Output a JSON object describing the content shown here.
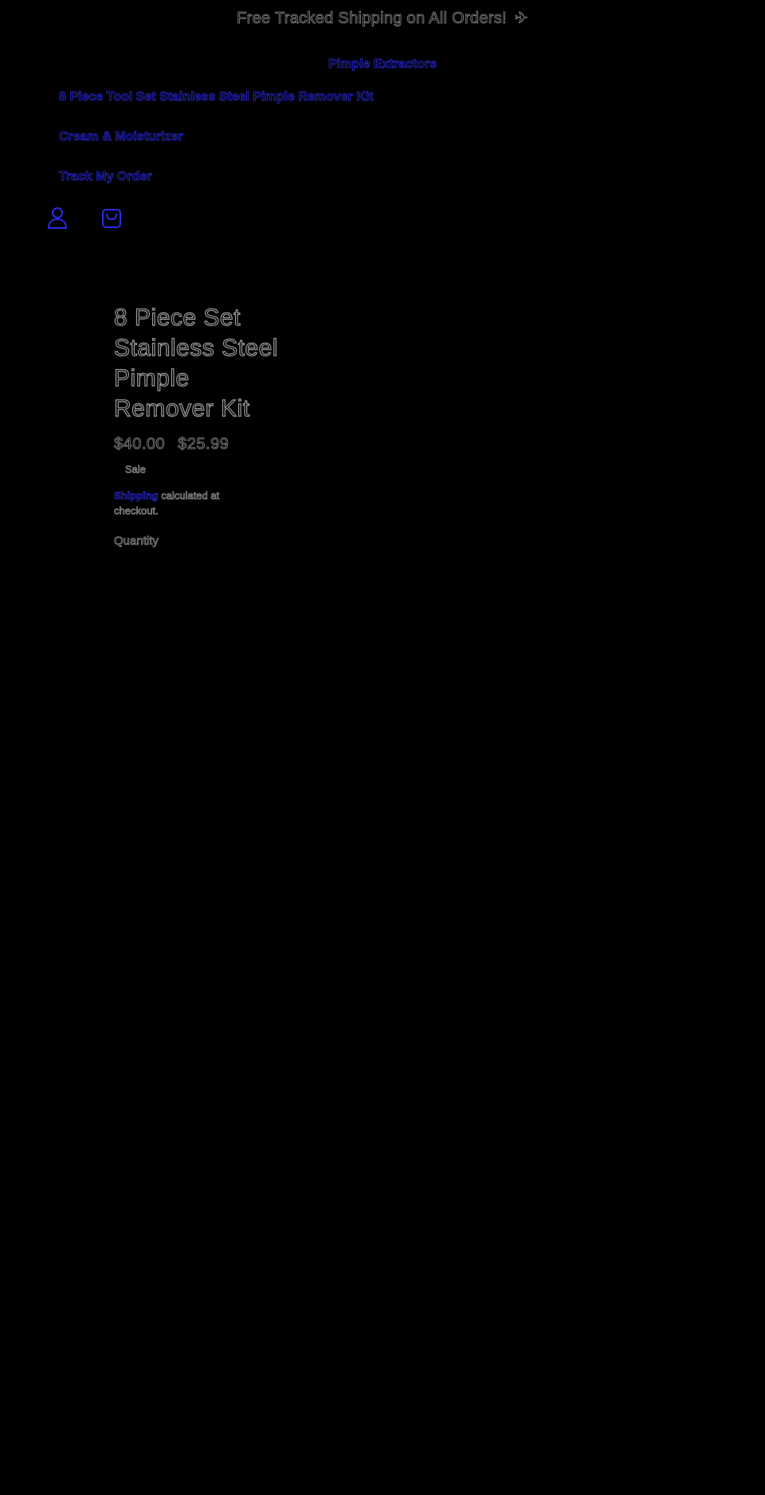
{
  "announcement": {
    "text": "Free Tracked Shipping on All Orders!",
    "icon": "airplane-icon",
    "icon_glyph": "✈"
  },
  "nav": {
    "center_link": "Pimple Extractors",
    "items": [
      {
        "label": "8 Piece Tool Set Stainless Steel Pimple Remover Kit"
      },
      {
        "label": "Cream & Moisturizer"
      },
      {
        "label": "Track My Order"
      }
    ]
  },
  "header_icons": {
    "account": "account-icon",
    "cart": "cart-icon"
  },
  "product": {
    "title_lines": [
      "8 Piece Set",
      "Stainless Steel",
      "Pimple",
      "Remover Kit"
    ],
    "regular_price": "$40.00",
    "sale_price": "$25.99",
    "badge": "Sale",
    "shipping_link": "Shipping",
    "shipping_text": " calculated at checkout.",
    "quantity_label": "Quantity"
  },
  "colors": {
    "background": "#000000",
    "link_blue": "#2a2ae8",
    "outline_grey": "#8a8a8a"
  }
}
